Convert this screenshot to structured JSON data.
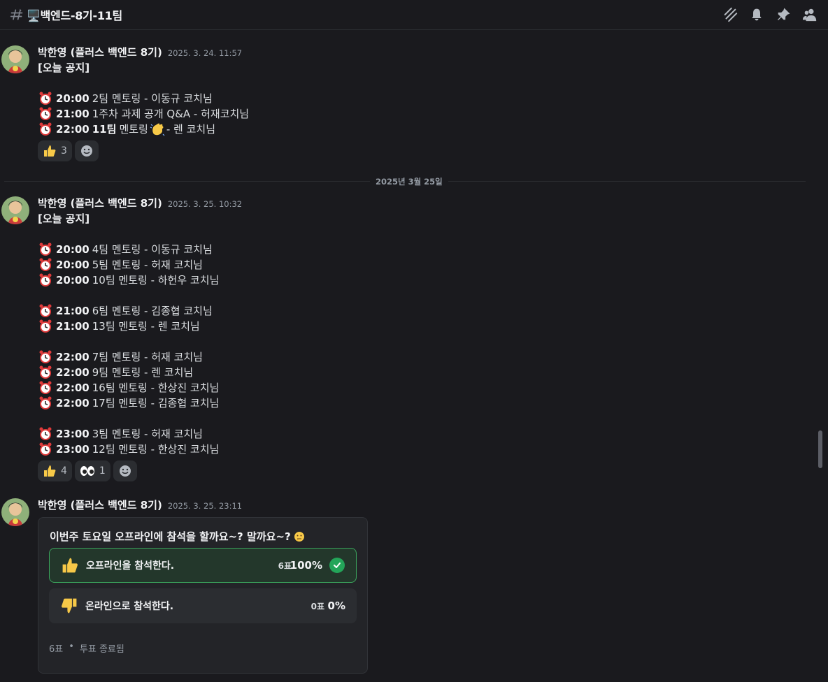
{
  "header": {
    "channel": "🖥️백엔드-8기-11팀",
    "icons": [
      "threads-icon",
      "bell-icon",
      "pin-icon",
      "members-icon"
    ]
  },
  "messages": [
    {
      "author": "박한영 (플러스 백엔드 8기)",
      "time": "2025. 3. 24. 11:57",
      "title": "[오늘 공지]",
      "lines": [
        {
          "time": "20:00",
          "text": "2팀 멘토링 - 이동규 코치님"
        },
        {
          "time": "21:00",
          "text": "1주차 과제 공개 Q&A - 허재코치님"
        },
        {
          "time": "22:00",
          "bold2": "11팀",
          "text": "멘토링",
          "after": "- 렌 코치님"
        }
      ],
      "reactions": [
        {
          "emoji": "thumbs-up",
          "count": "3"
        }
      ]
    },
    {
      "author": "박한영 (플러스 백엔드 8기)",
      "time": "2025. 3. 25. 10:32",
      "title": "[오늘 공지]",
      "lines": [
        {
          "time": "20:00",
          "text": "4팀 멘토링 - 이동규 코치님"
        },
        {
          "time": "20:00",
          "text": "5팀 멘토링 - 허재 코치님"
        },
        {
          "time": "20:00",
          "text": "10팀 멘토링 - 하헌우 코치님"
        },
        {
          "time": "21:00",
          "text": "6팀 멘토링 - 김종협 코치님"
        },
        {
          "time": "21:00",
          "text": "13팀 멘토링 - 렌 코치님"
        },
        {
          "time": "22:00",
          "text": "7팀 멘토링 - 허재 코치님"
        },
        {
          "time": "22:00",
          "text": "9팀 멘토링 - 렌 코치님"
        },
        {
          "time": "22:00",
          "text": "16팀 멘토링 - 한상진 코치님"
        },
        {
          "time": "22:00",
          "text": "17팀 멘토링 - 김종협 코치님"
        },
        {
          "time": "23:00",
          "text": "3팀 멘토링 - 허재 코치님"
        },
        {
          "time": "23:00",
          "text": "12팀 멘토링 - 한상진 코치님"
        }
      ],
      "reactions": [
        {
          "emoji": "thumbs-up",
          "count": "4"
        },
        {
          "emoji": "eyes",
          "count": "1"
        }
      ]
    },
    {
      "author": "박한영 (플러스 백엔드 8기)",
      "time": "2025. 3. 25. 23:11"
    }
  ],
  "divider": "2025년 3월 25일",
  "poll": {
    "question": "이번주 토요일 오프라인에 참석을 할까요~? 말까요~?",
    "options": [
      {
        "label": "오프라인을 참석한다.",
        "votes": "6표",
        "percent": "100%",
        "percent_value": 1.0,
        "selected": true
      },
      {
        "label": "온라인으로 참석한다.",
        "votes": "0표",
        "percent": "0%",
        "percent_value": 0.0,
        "selected": false
      }
    ],
    "total": "6표",
    "status": "투표 종료됨"
  },
  "colors": {
    "accent_green": "#3ba55c",
    "background": "#1a1a1e"
  }
}
